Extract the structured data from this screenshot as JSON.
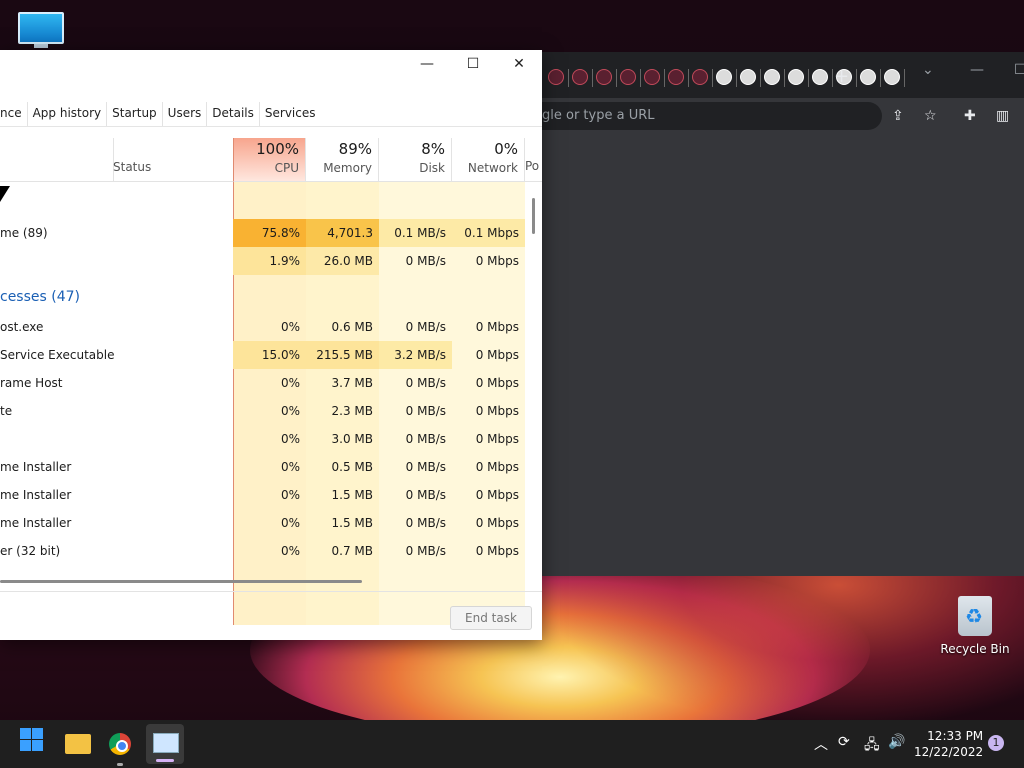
{
  "desktop": {
    "recycle_bin_label": "Recycle Bin"
  },
  "chrome": {
    "new_tab_symbol": "+",
    "omnibox_placeholder": "gle or type a URL"
  },
  "task_manager": {
    "tabs": [
      "nce",
      "App history",
      "Startup",
      "Users",
      "Details",
      "Services"
    ],
    "status_header": "Status",
    "columns": [
      {
        "pct": "100%",
        "label": "CPU"
      },
      {
        "pct": "89%",
        "label": "Memory"
      },
      {
        "pct": "8%",
        "label": "Disk"
      },
      {
        "pct": "0%",
        "label": "Network"
      },
      {
        "pct": "",
        "label": "Po"
      }
    ],
    "rows": [
      {
        "name": "me (89)",
        "cpu": "75.8%",
        "memory": "4,701.3 MB",
        "disk": "0.1 MB/s",
        "network": "0.1 Mbps"
      },
      {
        "name": "",
        "cpu": "1.9%",
        "memory": "26.0 MB",
        "disk": "0 MB/s",
        "network": "0 Mbps"
      }
    ],
    "group_label": "cesses (47)",
    "bg_rows": [
      {
        "name": "ost.exe",
        "cpu": "0%",
        "memory": "0.6 MB",
        "disk": "0 MB/s",
        "network": "0 Mbps"
      },
      {
        "name": "Service Executable",
        "cpu": "15.0%",
        "memory": "215.5 MB",
        "disk": "3.2 MB/s",
        "network": "0 Mbps"
      },
      {
        "name": "rame Host",
        "cpu": "0%",
        "memory": "3.7 MB",
        "disk": "0 MB/s",
        "network": "0 Mbps"
      },
      {
        "name": "te",
        "cpu": "0%",
        "memory": "2.3 MB",
        "disk": "0 MB/s",
        "network": "0 Mbps"
      },
      {
        "name": "",
        "cpu": "0%",
        "memory": "3.0 MB",
        "disk": "0 MB/s",
        "network": "0 Mbps"
      },
      {
        "name": "me Installer",
        "cpu": "0%",
        "memory": "0.5 MB",
        "disk": "0 MB/s",
        "network": "0 Mbps"
      },
      {
        "name": "me Installer",
        "cpu": "0%",
        "memory": "1.5 MB",
        "disk": "0 MB/s",
        "network": "0 Mbps"
      },
      {
        "name": "me Installer",
        "cpu": "0%",
        "memory": "1.5 MB",
        "disk": "0 MB/s",
        "network": "0 Mbps"
      },
      {
        "name": "er (32 bit)",
        "cpu": "0%",
        "memory": "0.7 MB",
        "disk": "0 MB/s",
        "network": "0 Mbps"
      }
    ],
    "end_task_label": "End task"
  },
  "taskbar": {
    "time": "12:33 PM",
    "date": "12/22/2022",
    "notification_count": "1"
  }
}
